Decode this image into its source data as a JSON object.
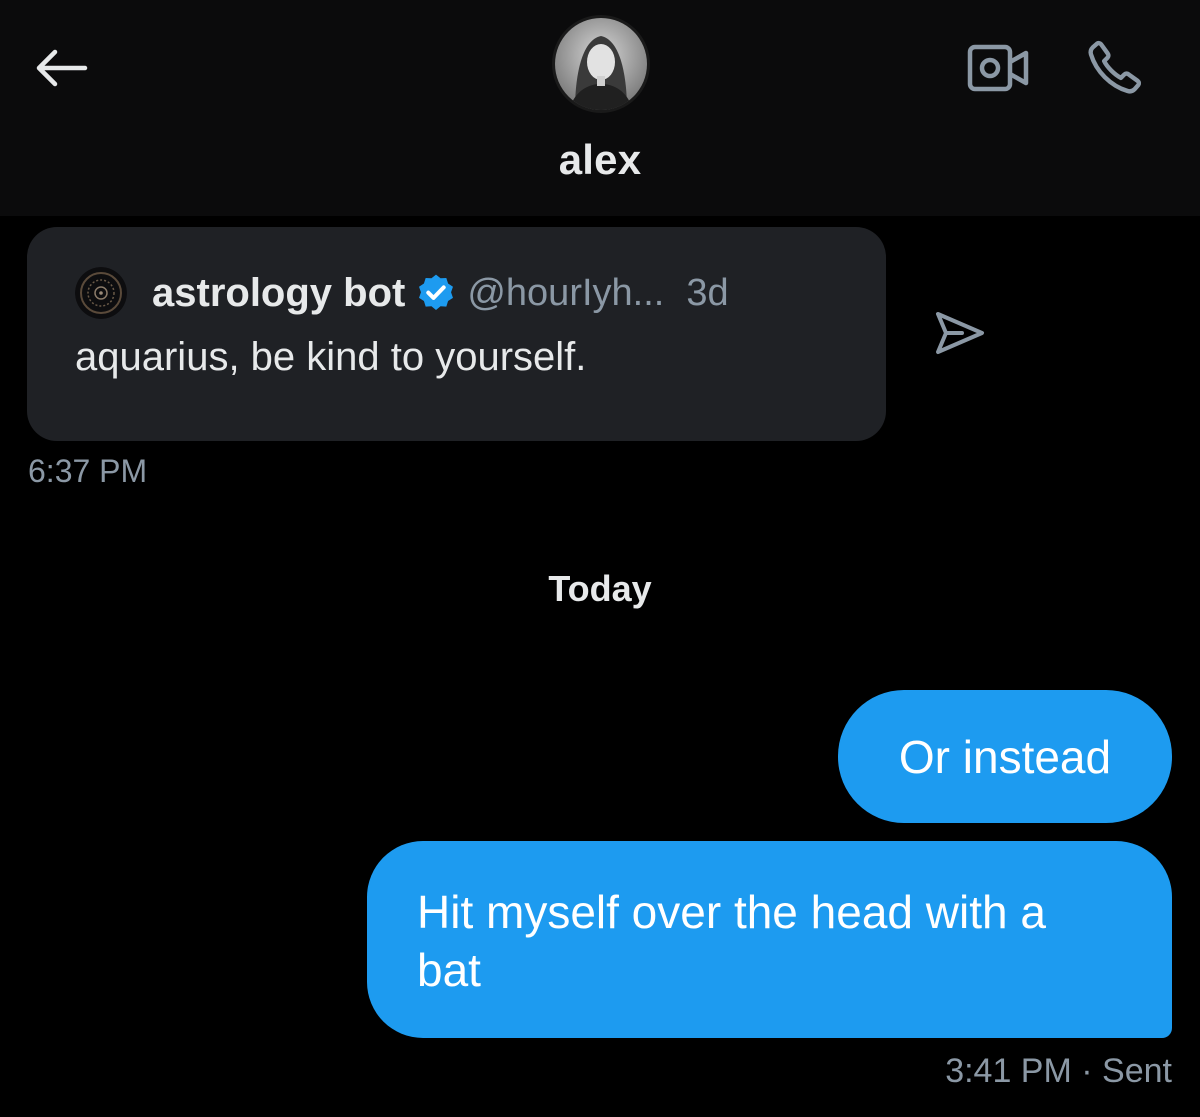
{
  "header": {
    "contact_name": "alex",
    "back_icon": "arrow-left-icon",
    "video_icon": "video-camera-icon",
    "call_icon": "phone-icon"
  },
  "messages": {
    "shared_tweet": {
      "author_name": "astrology bot",
      "verified": true,
      "handle": "@hourIyh...",
      "time_ago": "3d",
      "text": "aquarius, be kind to yourself."
    },
    "shared_tweet_timestamp": "6:37 PM",
    "day_separator": "Today",
    "sent": [
      {
        "text": "Or instead"
      },
      {
        "text": "Hit myself over the head with a bat"
      }
    ],
    "sent_timestamp": "3:41 PM",
    "sent_status": "Sent"
  },
  "colors": {
    "background": "#000000",
    "header_bg": "#0b0b0c",
    "card_bg": "#1f2125",
    "accent_blue": "#1d9bf0",
    "secondary_text": "#8b98a5"
  }
}
